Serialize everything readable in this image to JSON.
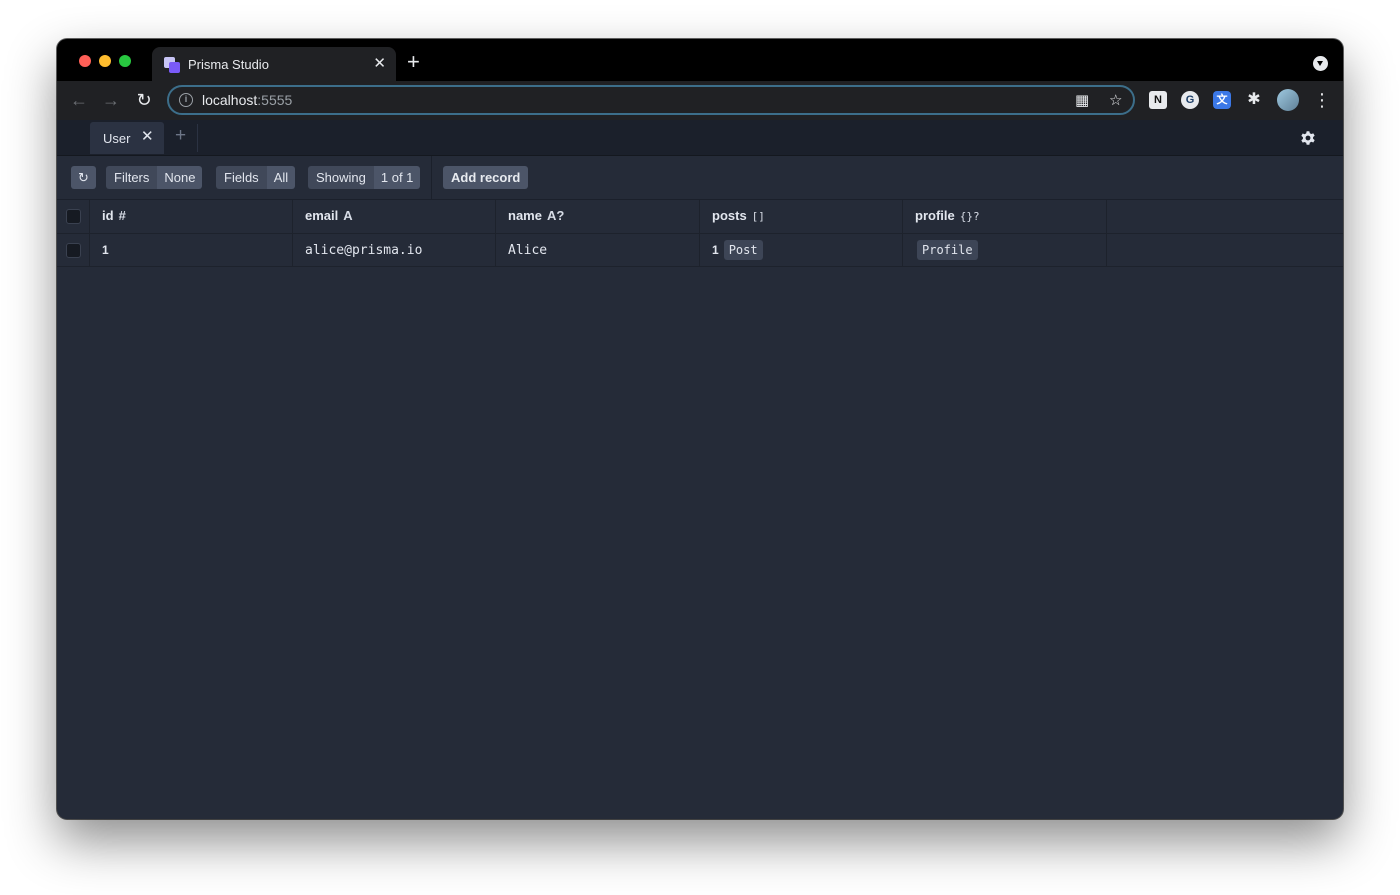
{
  "browser": {
    "tab_title": "Prisma Studio",
    "tab_close": "✕",
    "new_tab": "+",
    "url_host": "localhost",
    "url_port": ":5555"
  },
  "app": {
    "tabs": [
      {
        "label": "User"
      }
    ],
    "add_tab": "+"
  },
  "actions": {
    "refresh_icon": "↻",
    "filters": {
      "label": "Filters",
      "value": "None"
    },
    "fields": {
      "label": "Fields",
      "value": "All"
    },
    "showing": {
      "label": "Showing",
      "value": "1 of 1"
    },
    "add_record": "Add record"
  },
  "table": {
    "columns": [
      {
        "name": "id",
        "type": "#"
      },
      {
        "name": "email",
        "type": "A"
      },
      {
        "name": "name",
        "type": "A?"
      },
      {
        "name": "posts",
        "type": "[]"
      },
      {
        "name": "profile",
        "type": "{}?"
      }
    ],
    "rows": [
      {
        "id": "1",
        "email": "alice@prisma.io",
        "name": "Alice",
        "posts_count": "1",
        "posts_label": "Post",
        "profile_label": "Profile"
      }
    ]
  },
  "colors": {
    "background": "#252b38",
    "tabbar": "#1b202b",
    "button": "#4c5568",
    "accent_favicon": "#7a5af8"
  }
}
